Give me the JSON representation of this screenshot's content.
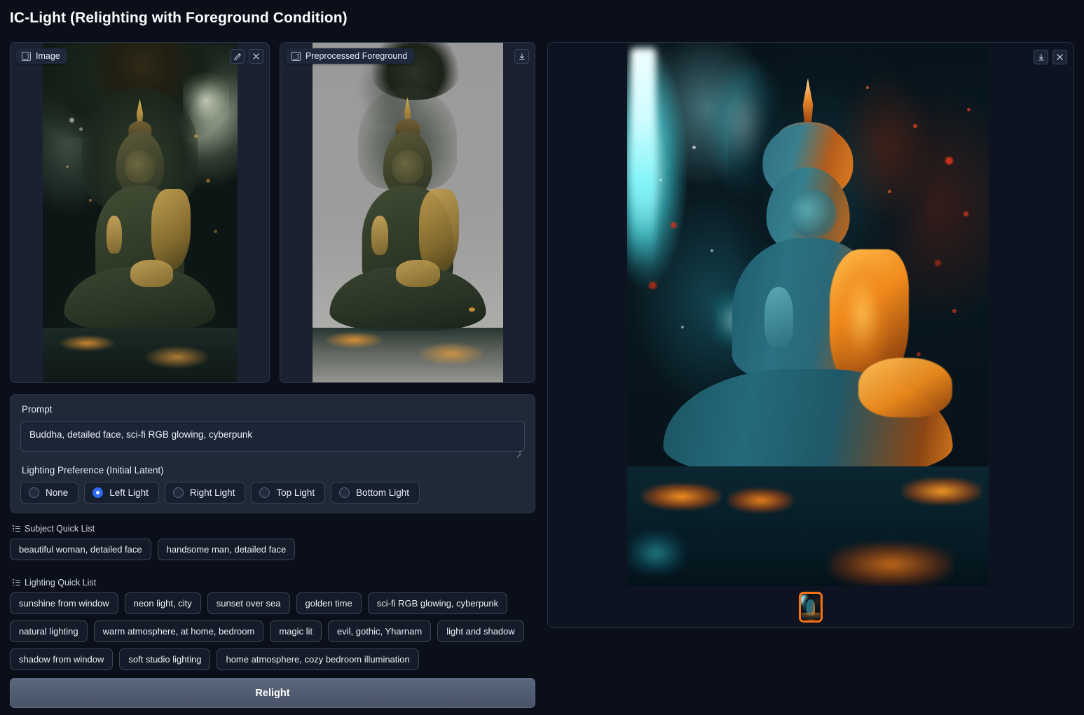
{
  "header": {
    "title": "IC-Light (Relighting with Foreground Condition)"
  },
  "input_panel": {
    "label": "Image",
    "label_icon": "image-icon",
    "edit_icon": "pencil-icon",
    "close_icon": "close-icon"
  },
  "preprocessed_panel": {
    "label": "Preprocessed Foreground",
    "label_icon": "image-icon",
    "download_icon": "download-icon"
  },
  "prompt": {
    "label": "Prompt",
    "value": "Buddha, detailed face, sci-fi RGB glowing, cyberpunk",
    "placeholder": "Prompt"
  },
  "lighting_preference": {
    "label": "Lighting Preference (Initial Latent)",
    "selected": "Left Light",
    "options": [
      {
        "label": "None",
        "selected": false
      },
      {
        "label": "Left Light",
        "selected": true
      },
      {
        "label": "Right Light",
        "selected": false
      },
      {
        "label": "Top Light",
        "selected": false
      },
      {
        "label": "Bottom Light",
        "selected": false
      }
    ]
  },
  "subject_quick_list": {
    "label": "Subject Quick List",
    "icon": "list-icon",
    "items": [
      "beautiful woman, detailed face",
      "handsome man, detailed face"
    ]
  },
  "lighting_quick_list": {
    "label": "Lighting Quick List",
    "icon": "list-icon",
    "items": [
      "sunshine from window",
      "neon light, city",
      "sunset over sea",
      "golden time",
      "sci-fi RGB glowing, cyberpunk",
      "natural lighting",
      "warm atmosphere, at home, bedroom",
      "magic lit",
      "evil, gothic, Yharnam",
      "light and shadow",
      "shadow from window",
      "soft studio lighting",
      "home atmosphere, cozy bedroom illumination"
    ]
  },
  "actions": {
    "relight_label": "Relight"
  },
  "result_panel": {
    "download_icon": "download-icon",
    "close_icon": "close-icon",
    "gallery": {
      "selected_index": 0,
      "thumbnail_count": 1
    }
  },
  "colors": {
    "page_bg": "#0b0f19",
    "panel_bg": "#1f2937",
    "result_bg": "#0d1320",
    "accent_radio": "#2f6bf6",
    "accent_selection": "#f97316",
    "text": "#e8eaf0",
    "button_bg": "#515d72"
  }
}
